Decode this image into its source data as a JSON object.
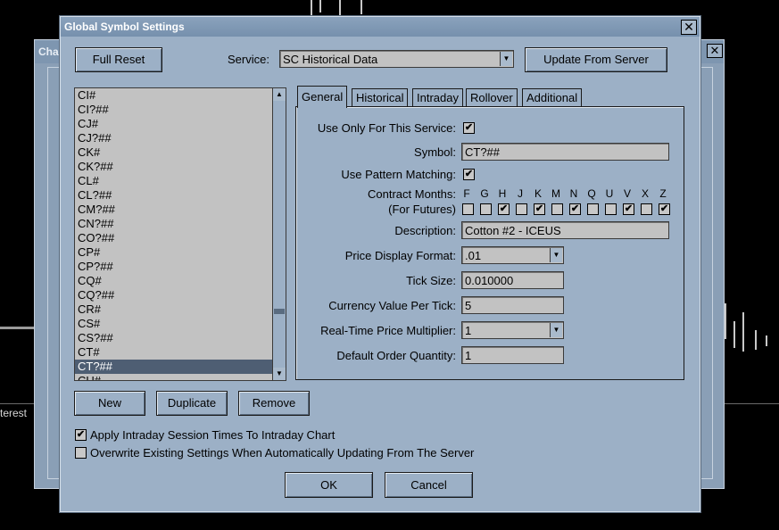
{
  "background": {
    "window_title_fragment": "Cha",
    "side_text": "terest"
  },
  "dialog": {
    "title": "Global Symbol Settings",
    "close_glyph": "✕",
    "full_reset": "Full Reset",
    "service_label": "Service:",
    "service_value": "SC Historical Data",
    "update_from_server": "Update From Server"
  },
  "symbols": [
    "CI#",
    "CI?##",
    "CJ#",
    "CJ?##",
    "CK#",
    "CK?##",
    "CL#",
    "CL?##",
    "CM?##",
    "CN?##",
    "CO?##",
    "CP#",
    "CP?##",
    "CQ#",
    "CQ?##",
    "CR#",
    "CS#",
    "CS?##",
    "CT#",
    "CT?##",
    "CU#"
  ],
  "selected_symbol": "CT?##",
  "tabs": [
    "General",
    "Historical",
    "Intraday",
    "Rollover",
    "Additional"
  ],
  "active_tab": "General",
  "general": {
    "use_only_label": "Use Only For This Service:",
    "use_only_checked": true,
    "symbol_label": "Symbol:",
    "symbol_value": "CT?##",
    "pattern_label": "Use Pattern Matching:",
    "pattern_checked": true,
    "contract_months_label": "Contract Months:",
    "for_futures_label": "(For Futures)",
    "months": [
      {
        "letter": "F",
        "checked": false
      },
      {
        "letter": "G",
        "checked": false
      },
      {
        "letter": "H",
        "checked": true
      },
      {
        "letter": "J",
        "checked": false
      },
      {
        "letter": "K",
        "checked": true
      },
      {
        "letter": "M",
        "checked": false
      },
      {
        "letter": "N",
        "checked": true
      },
      {
        "letter": "Q",
        "checked": false
      },
      {
        "letter": "U",
        "checked": false
      },
      {
        "letter": "V",
        "checked": true
      },
      {
        "letter": "X",
        "checked": false
      },
      {
        "letter": "Z",
        "checked": true
      }
    ],
    "description_label": "Description:",
    "description_value": "Cotton #2 - ICEUS",
    "price_format_label": "Price Display Format:",
    "price_format_value": ".01",
    "tick_size_label": "Tick Size:",
    "tick_size_value": "0.010000",
    "currency_label": "Currency Value Per Tick:",
    "currency_value": "5",
    "multiplier_label": "Real-Time Price Multiplier:",
    "multiplier_value": "1",
    "order_qty_label": "Default Order Quantity:",
    "order_qty_value": "1"
  },
  "list_buttons": {
    "new": "New",
    "duplicate": "Duplicate",
    "remove": "Remove"
  },
  "options": {
    "apply_session_label": "Apply Intraday Session Times To Intraday Chart",
    "apply_session_checked": true,
    "overwrite_label": "Overwrite Existing Settings When Automatically Updating From The Server",
    "overwrite_checked": false
  },
  "footer": {
    "ok": "OK",
    "cancel": "Cancel"
  },
  "colors": {
    "dialog_bg": "#9cb0c6",
    "field_bg": "#c2c2c2",
    "selection": "#4e5e73",
    "titlebar": "#7690ad"
  }
}
